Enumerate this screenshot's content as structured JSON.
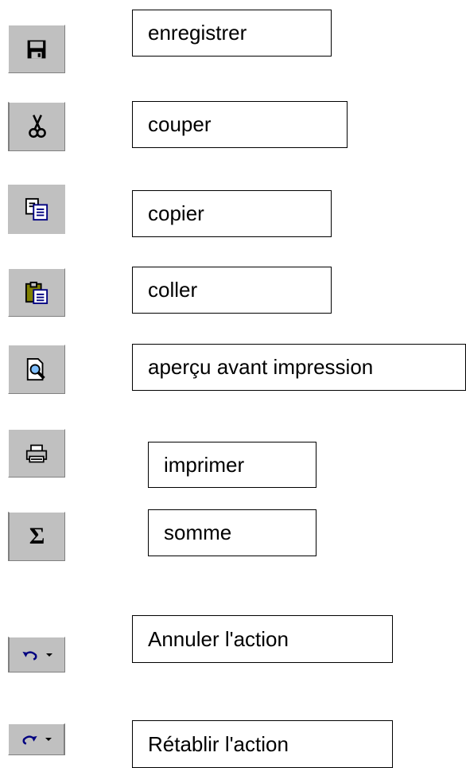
{
  "toolbar_items": [
    {
      "icon": "save-icon",
      "label": "enregistrer"
    },
    {
      "icon": "cut-icon",
      "label": "couper"
    },
    {
      "icon": "copy-icon",
      "label": "copier"
    },
    {
      "icon": "paste-icon",
      "label": "coller"
    },
    {
      "icon": "print-preview-icon",
      "label": "aperçu avant impression"
    },
    {
      "icon": "print-icon",
      "label": "imprimer"
    },
    {
      "icon": "sum-icon",
      "label": "somme",
      "glyph": "Σ"
    },
    {
      "icon": "undo-icon",
      "label": "Annuler l'action"
    },
    {
      "icon": "redo-icon",
      "label": "Rétablir l'action"
    }
  ],
  "colors": {
    "button_face": "#c0c0c0",
    "icon_blue": "#000080",
    "label_border": "#000000"
  }
}
